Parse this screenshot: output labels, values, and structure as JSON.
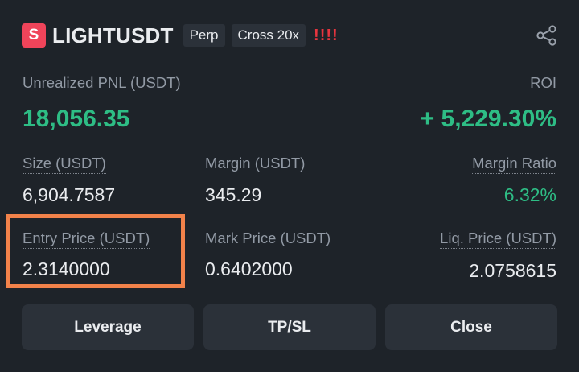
{
  "header": {
    "badge_letter": "S",
    "symbol": "LIGHTUSDT",
    "tags": [
      "Perp",
      "Cross 20x"
    ],
    "warning": "!!!!"
  },
  "pnl": {
    "label": "Unrealized PNL (USDT)",
    "value": "18,056.35",
    "roi_label": "ROI",
    "roi_value": "+ 5,229.30%"
  },
  "stats_row1": {
    "size_label": "Size (USDT)",
    "size_value": "6,904.7587",
    "margin_label": "Margin (USDT)",
    "margin_value": "345.29",
    "margin_ratio_label": "Margin Ratio",
    "margin_ratio_value": "6.32%"
  },
  "stats_row2": {
    "entry_label": "Entry Price (USDT)",
    "entry_value": "2.3140000",
    "mark_label": "Mark Price (USDT)",
    "mark_value": "0.6402000",
    "liq_label": "Liq. Price (USDT)",
    "liq_value": "2.0758615"
  },
  "buttons": {
    "leverage": "Leverage",
    "tpsl": "TP/SL",
    "close": "Close"
  },
  "colors": {
    "background": "#1e2329",
    "positive": "#2ebd85",
    "warning": "#e8353f",
    "highlight": "#f2824a",
    "badge": "#f0445a"
  },
  "icons": {
    "share": "share-icon"
  }
}
